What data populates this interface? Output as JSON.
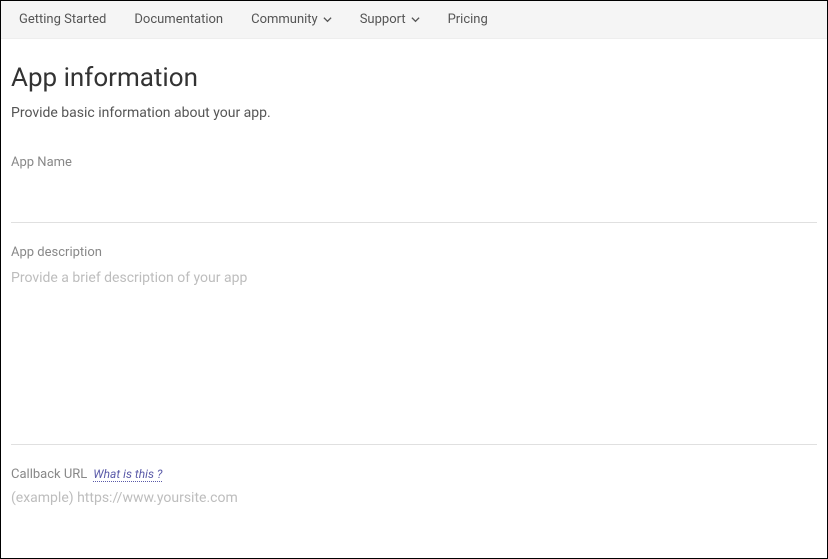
{
  "nav": {
    "items": [
      {
        "label": "Getting Started",
        "has_dropdown": false
      },
      {
        "label": "Documentation",
        "has_dropdown": false
      },
      {
        "label": "Community",
        "has_dropdown": true
      },
      {
        "label": "Support",
        "has_dropdown": true
      },
      {
        "label": "Pricing",
        "has_dropdown": false
      }
    ]
  },
  "page": {
    "title": "App information",
    "subtitle": "Provide basic information about your app."
  },
  "fields": {
    "app_name": {
      "label": "App Name",
      "value": "",
      "placeholder": ""
    },
    "app_description": {
      "label": "App description",
      "value": "",
      "placeholder": "Provide a brief description of your app"
    },
    "callback_url": {
      "label": "Callback URL",
      "help_text": "What is this ?",
      "value": "",
      "placeholder": "(example) https://www.yoursite.com"
    }
  }
}
